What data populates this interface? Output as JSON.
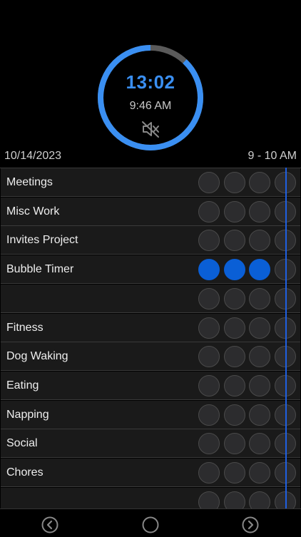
{
  "timer": {
    "countdown": "13:02",
    "clock": "9:46 AM",
    "progress": 0.88,
    "ring_color": "#3a8ff2",
    "track_color": "#5a5a5a"
  },
  "icons": {
    "mute": "speaker-muted-icon",
    "prev": "chevron-left-circle-icon",
    "home": "circle-icon",
    "next": "chevron-right-circle-icon"
  },
  "info": {
    "date": "10/14/2023",
    "range": "9 - 10 AM"
  },
  "rows": [
    {
      "label": "Meetings",
      "filled": [
        false,
        false,
        false,
        false
      ]
    },
    {
      "label": "Misc Work",
      "filled": [
        false,
        false,
        false,
        false
      ]
    },
    {
      "label": "Invites Project",
      "filled": [
        false,
        false,
        false,
        false
      ]
    },
    {
      "label": "Bubble Timer",
      "filled": [
        true,
        true,
        true,
        false
      ]
    },
    {
      "label": "",
      "filled": [
        false,
        false,
        false,
        false
      ]
    },
    {
      "label": "Fitness",
      "filled": [
        false,
        false,
        false,
        false
      ]
    },
    {
      "label": "Dog Waking",
      "filled": [
        false,
        false,
        false,
        false
      ]
    },
    {
      "label": "Eating",
      "filled": [
        false,
        false,
        false,
        false
      ]
    },
    {
      "label": "Napping",
      "filled": [
        false,
        false,
        false,
        false
      ]
    },
    {
      "label": "Social",
      "filled": [
        false,
        false,
        false,
        false
      ]
    },
    {
      "label": "Chores",
      "filled": [
        false,
        false,
        false,
        false
      ]
    },
    {
      "label": "",
      "filled": [
        false,
        false,
        false,
        false
      ]
    }
  ],
  "colors": {
    "bubble_on": "#0a5fd6",
    "now_line": "#1f5fe0"
  }
}
